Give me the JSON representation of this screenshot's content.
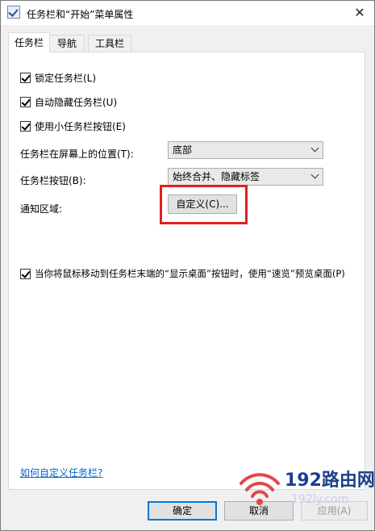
{
  "window": {
    "title": "任务栏和“开始”菜单属性",
    "close_symbol": "✕"
  },
  "tabs": [
    {
      "label": "任务栏",
      "active": true
    },
    {
      "label": "导航",
      "active": false
    },
    {
      "label": "工具栏",
      "active": false
    }
  ],
  "options": {
    "lock_taskbar": {
      "label": "锁定任务栏(L)",
      "checked": true
    },
    "auto_hide": {
      "label": "自动隐藏任务栏(U)",
      "checked": true
    },
    "small_buttons": {
      "label": "使用小任务栏按钮(E)",
      "checked": true
    }
  },
  "position": {
    "label": "任务栏在屏幕上的位置(T):",
    "value": "底部"
  },
  "buttons_setting": {
    "label": "任务栏按钮(B):",
    "value": "始终合并、隐藏标签"
  },
  "notification": {
    "label": "通知区域:",
    "customize_label": "自定义(C)..."
  },
  "peek": {
    "label": "当你将鼠标移动到任务栏末端的“显示桌面”按钮时，使用“速览”预览桌面(P)",
    "checked": true
  },
  "help_link": "如何自定义任务栏?",
  "footer": {
    "ok": "确定",
    "cancel": "取消",
    "apply": "应用(A)"
  },
  "watermark": {
    "text": "192路由网",
    "sub": "192ly.com"
  },
  "colors": {
    "highlight": "#e02020",
    "link": "#0066cc",
    "accent": "#0078d7"
  }
}
